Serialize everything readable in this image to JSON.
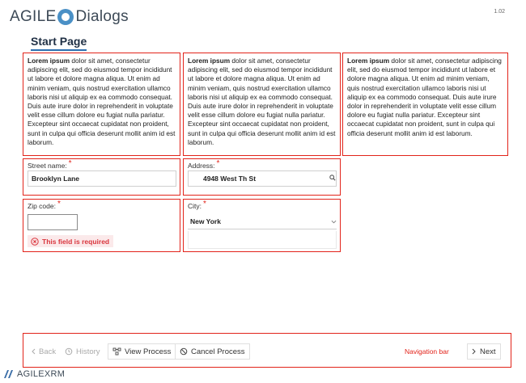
{
  "header": {
    "logo_left": "AGILE",
    "logo_right": "Dialogs",
    "version": "1.02"
  },
  "page": {
    "title": "Start Page"
  },
  "paragraphs": [
    {
      "lead": "Lorem ipsum",
      "text": " dolor sit amet, consectetur adipiscing elit, sed do eiusmod tempor incididunt ut labore et dolore magna aliqua. Ut enim ad minim veniam, quis nostrud exercitation ullamco laboris nisi ut aliquip ex ea commodo consequat. Duis aute irure dolor in reprehenderit in voluptate velit esse cillum dolore eu fugiat nulla pariatur. Excepteur sint occaecat cupidatat non proident, sunt in culpa qui officia deserunt mollit anim id est laborum."
    },
    {
      "lead": "Lorem ipsum",
      "text": " dolor sit amet, consectetur adipiscing elit, sed do eiusmod tempor incididunt ut labore et dolore magna aliqua. Ut enim ad minim veniam, quis nostrud exercitation ullamco laboris nisi ut aliquip ex ea commodo consequat. Duis aute irure dolor in reprehenderit in voluptate velit esse cillum dolore eu fugiat nulla pariatur. Excepteur sint occaecat cupidatat non proident, sunt in culpa qui officia deserunt mollit anim id est laborum."
    },
    {
      "lead": "Lorem ipsum",
      "text": " dolor sit amet, consectetur adipiscing elit, sed do eiusmod tempor incididunt ut labore et dolore magna aliqua. Ut enim ad minim veniam, quis nostrud exercitation ullamco laboris nisi ut aliquip ex ea commodo consequat. Duis aute irure dolor in reprehenderit in voluptate velit esse cillum dolore eu fugiat nulla pariatur. Excepteur sint occaecat cupidatat non proident, sunt in culpa qui officia deserunt mollit anim id est laborum."
    }
  ],
  "form": {
    "required_marker": "*",
    "street": {
      "label": "Street name:",
      "value": "Brooklyn Lane"
    },
    "address": {
      "label": "Address:",
      "value": "4948 West Th St",
      "icon": "search-icon"
    },
    "zip": {
      "label": "Zip code:",
      "value": "",
      "error": "This field is required",
      "error_icon": "error-circle-icon"
    },
    "city": {
      "label": "City:",
      "value": "New York",
      "icon": "chevron-down-icon"
    }
  },
  "navbar": {
    "label": "Navigation bar",
    "back": "Back",
    "history": "History",
    "view_process": "View Process",
    "cancel_process": "Cancel Process",
    "next": "Next"
  },
  "footer": {
    "logo": "AGILEXRM"
  },
  "colors": {
    "highlight": "#e2231a",
    "accent": "#2c6fb0",
    "logo_blue": "#4a90c6",
    "error_text": "#d9363e",
    "error_bg": "#fbe9ea"
  }
}
